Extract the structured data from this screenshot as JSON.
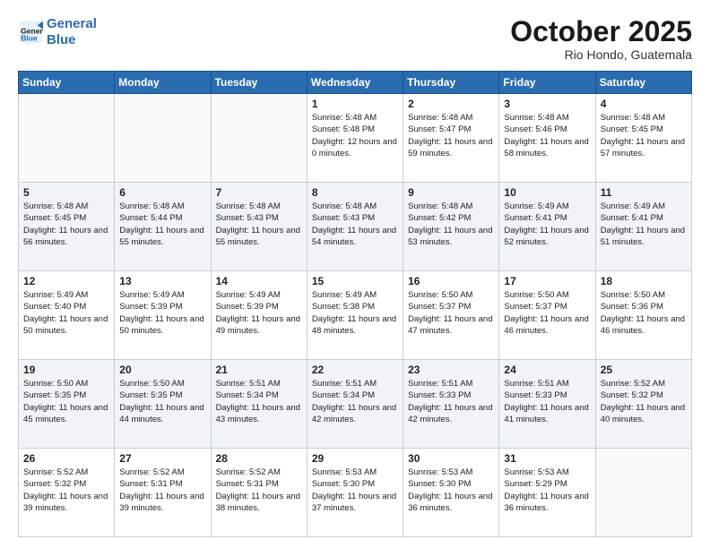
{
  "header": {
    "logo_line1": "General",
    "logo_line2": "Blue",
    "month_title": "October 2025",
    "location": "Rio Hondo, Guatemala"
  },
  "weekdays": [
    "Sunday",
    "Monday",
    "Tuesday",
    "Wednesday",
    "Thursday",
    "Friday",
    "Saturday"
  ],
  "weeks": [
    [
      {
        "day": "",
        "sunrise": "",
        "sunset": "",
        "daylight": "",
        "empty": true
      },
      {
        "day": "",
        "sunrise": "",
        "sunset": "",
        "daylight": "",
        "empty": true
      },
      {
        "day": "",
        "sunrise": "",
        "sunset": "",
        "daylight": "",
        "empty": true
      },
      {
        "day": "1",
        "sunrise": "Sunrise: 5:48 AM",
        "sunset": "Sunset: 5:48 PM",
        "daylight": "Daylight: 12 hours and 0 minutes.",
        "empty": false
      },
      {
        "day": "2",
        "sunrise": "Sunrise: 5:48 AM",
        "sunset": "Sunset: 5:47 PM",
        "daylight": "Daylight: 11 hours and 59 minutes.",
        "empty": false
      },
      {
        "day": "3",
        "sunrise": "Sunrise: 5:48 AM",
        "sunset": "Sunset: 5:46 PM",
        "daylight": "Daylight: 11 hours and 58 minutes.",
        "empty": false
      },
      {
        "day": "4",
        "sunrise": "Sunrise: 5:48 AM",
        "sunset": "Sunset: 5:45 PM",
        "daylight": "Daylight: 11 hours and 57 minutes.",
        "empty": false
      }
    ],
    [
      {
        "day": "5",
        "sunrise": "Sunrise: 5:48 AM",
        "sunset": "Sunset: 5:45 PM",
        "daylight": "Daylight: 11 hours and 56 minutes.",
        "empty": false
      },
      {
        "day": "6",
        "sunrise": "Sunrise: 5:48 AM",
        "sunset": "Sunset: 5:44 PM",
        "daylight": "Daylight: 11 hours and 55 minutes.",
        "empty": false
      },
      {
        "day": "7",
        "sunrise": "Sunrise: 5:48 AM",
        "sunset": "Sunset: 5:43 PM",
        "daylight": "Daylight: 11 hours and 55 minutes.",
        "empty": false
      },
      {
        "day": "8",
        "sunrise": "Sunrise: 5:48 AM",
        "sunset": "Sunset: 5:43 PM",
        "daylight": "Daylight: 11 hours and 54 minutes.",
        "empty": false
      },
      {
        "day": "9",
        "sunrise": "Sunrise: 5:48 AM",
        "sunset": "Sunset: 5:42 PM",
        "daylight": "Daylight: 11 hours and 53 minutes.",
        "empty": false
      },
      {
        "day": "10",
        "sunrise": "Sunrise: 5:49 AM",
        "sunset": "Sunset: 5:41 PM",
        "daylight": "Daylight: 11 hours and 52 minutes.",
        "empty": false
      },
      {
        "day": "11",
        "sunrise": "Sunrise: 5:49 AM",
        "sunset": "Sunset: 5:41 PM",
        "daylight": "Daylight: 11 hours and 51 minutes.",
        "empty": false
      }
    ],
    [
      {
        "day": "12",
        "sunrise": "Sunrise: 5:49 AM",
        "sunset": "Sunset: 5:40 PM",
        "daylight": "Daylight: 11 hours and 50 minutes.",
        "empty": false
      },
      {
        "day": "13",
        "sunrise": "Sunrise: 5:49 AM",
        "sunset": "Sunset: 5:39 PM",
        "daylight": "Daylight: 11 hours and 50 minutes.",
        "empty": false
      },
      {
        "day": "14",
        "sunrise": "Sunrise: 5:49 AM",
        "sunset": "Sunset: 5:39 PM",
        "daylight": "Daylight: 11 hours and 49 minutes.",
        "empty": false
      },
      {
        "day": "15",
        "sunrise": "Sunrise: 5:49 AM",
        "sunset": "Sunset: 5:38 PM",
        "daylight": "Daylight: 11 hours and 48 minutes.",
        "empty": false
      },
      {
        "day": "16",
        "sunrise": "Sunrise: 5:50 AM",
        "sunset": "Sunset: 5:37 PM",
        "daylight": "Daylight: 11 hours and 47 minutes.",
        "empty": false
      },
      {
        "day": "17",
        "sunrise": "Sunrise: 5:50 AM",
        "sunset": "Sunset: 5:37 PM",
        "daylight": "Daylight: 11 hours and 46 minutes.",
        "empty": false
      },
      {
        "day": "18",
        "sunrise": "Sunrise: 5:50 AM",
        "sunset": "Sunset: 5:36 PM",
        "daylight": "Daylight: 11 hours and 46 minutes.",
        "empty": false
      }
    ],
    [
      {
        "day": "19",
        "sunrise": "Sunrise: 5:50 AM",
        "sunset": "Sunset: 5:35 PM",
        "daylight": "Daylight: 11 hours and 45 minutes.",
        "empty": false
      },
      {
        "day": "20",
        "sunrise": "Sunrise: 5:50 AM",
        "sunset": "Sunset: 5:35 PM",
        "daylight": "Daylight: 11 hours and 44 minutes.",
        "empty": false
      },
      {
        "day": "21",
        "sunrise": "Sunrise: 5:51 AM",
        "sunset": "Sunset: 5:34 PM",
        "daylight": "Daylight: 11 hours and 43 minutes.",
        "empty": false
      },
      {
        "day": "22",
        "sunrise": "Sunrise: 5:51 AM",
        "sunset": "Sunset: 5:34 PM",
        "daylight": "Daylight: 11 hours and 42 minutes.",
        "empty": false
      },
      {
        "day": "23",
        "sunrise": "Sunrise: 5:51 AM",
        "sunset": "Sunset: 5:33 PM",
        "daylight": "Daylight: 11 hours and 42 minutes.",
        "empty": false
      },
      {
        "day": "24",
        "sunrise": "Sunrise: 5:51 AM",
        "sunset": "Sunset: 5:33 PM",
        "daylight": "Daylight: 11 hours and 41 minutes.",
        "empty": false
      },
      {
        "day": "25",
        "sunrise": "Sunrise: 5:52 AM",
        "sunset": "Sunset: 5:32 PM",
        "daylight": "Daylight: 11 hours and 40 minutes.",
        "empty": false
      }
    ],
    [
      {
        "day": "26",
        "sunrise": "Sunrise: 5:52 AM",
        "sunset": "Sunset: 5:32 PM",
        "daylight": "Daylight: 11 hours and 39 minutes.",
        "empty": false
      },
      {
        "day": "27",
        "sunrise": "Sunrise: 5:52 AM",
        "sunset": "Sunset: 5:31 PM",
        "daylight": "Daylight: 11 hours and 39 minutes.",
        "empty": false
      },
      {
        "day": "28",
        "sunrise": "Sunrise: 5:52 AM",
        "sunset": "Sunset: 5:31 PM",
        "daylight": "Daylight: 11 hours and 38 minutes.",
        "empty": false
      },
      {
        "day": "29",
        "sunrise": "Sunrise: 5:53 AM",
        "sunset": "Sunset: 5:30 PM",
        "daylight": "Daylight: 11 hours and 37 minutes.",
        "empty": false
      },
      {
        "day": "30",
        "sunrise": "Sunrise: 5:53 AM",
        "sunset": "Sunset: 5:30 PM",
        "daylight": "Daylight: 11 hours and 36 minutes.",
        "empty": false
      },
      {
        "day": "31",
        "sunrise": "Sunrise: 5:53 AM",
        "sunset": "Sunset: 5:29 PM",
        "daylight": "Daylight: 11 hours and 36 minutes.",
        "empty": false
      },
      {
        "day": "",
        "sunrise": "",
        "sunset": "",
        "daylight": "",
        "empty": true
      }
    ]
  ]
}
